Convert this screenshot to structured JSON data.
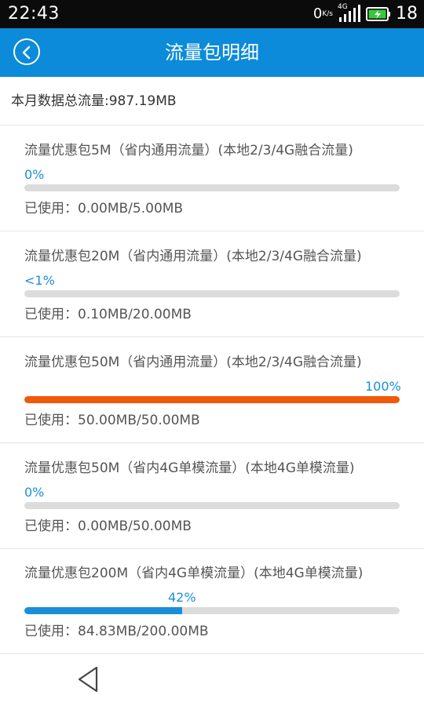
{
  "status_bar": {
    "time": "22:43",
    "net_speed": "0",
    "net_speed_unit": "K/s",
    "network_type": "4G",
    "battery_level": "18",
    "icons": [
      "signal-icon",
      "battery-icon"
    ],
    "battery_color": "#38c93b"
  },
  "header": {
    "title": "流量包明细",
    "back_icon": "back-icon",
    "background": "#0b8bd9"
  },
  "summary": {
    "label": "本月数据总流量:",
    "value": "987.19MB"
  },
  "packages": [
    {
      "name": "流量优惠包5M（省内通用流量）(本地2/3/4G融合流量)",
      "percent_text": "0%",
      "progress": 0,
      "usage_label": "已使用：",
      "usage_value": "0.00MB/5.00MB"
    },
    {
      "name": "流量优惠包20M（省内通用流量）(本地2/3/4G融合流量)",
      "percent_text": "<1%",
      "progress": 0,
      "usage_label": "已使用：",
      "usage_value": "0.10MB/20.00MB"
    },
    {
      "name": "流量优惠包50M（省内通用流量）(本地2/3/4G融合流量)",
      "percent_text": "100%",
      "progress": 100,
      "usage_label": "已使用：",
      "usage_value": "50.00MB/50.00MB"
    },
    {
      "name": "流量优惠包50M（省内4G单模流量）(本地4G单模流量)",
      "percent_text": "0%",
      "progress": 0,
      "usage_label": "已使用：",
      "usage_value": "0.00MB/50.00MB"
    },
    {
      "name": "流量优惠包200M（省内4G单模流量）(本地4G单模流量)",
      "percent_text": "42%",
      "progress": 42,
      "usage_label": "已使用：",
      "usage_value": "84.83MB/200.00MB"
    }
  ],
  "colors": {
    "progress_normal": "#1a8fd8",
    "progress_full": "#f05a0a",
    "track": "#dcdcdc",
    "percent_text": "#1a8fd8"
  },
  "nav_bar": {
    "back_icon": "nav-back-icon"
  }
}
